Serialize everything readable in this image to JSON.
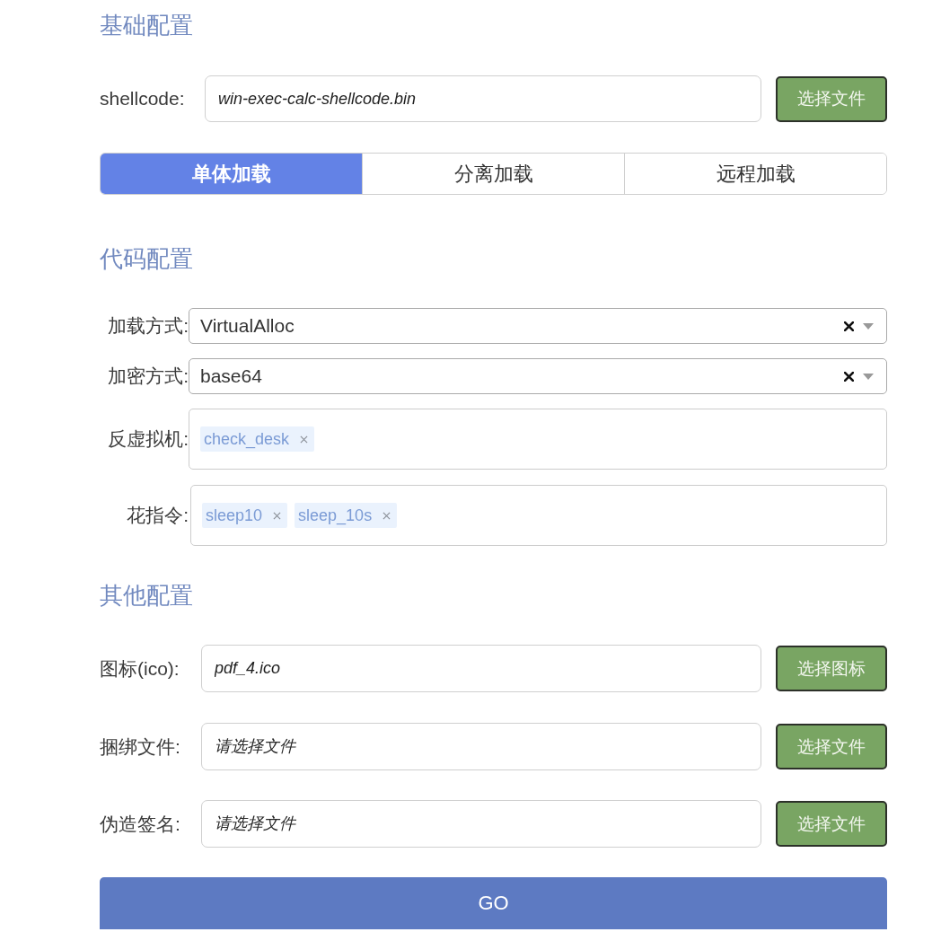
{
  "basic": {
    "title": "基础配置",
    "shellcode": {
      "label": "shellcode:",
      "value": "win-exec-calc-shellcode.bin",
      "button": "选择文件"
    },
    "modes": [
      {
        "label": "单体加载",
        "selected": true
      },
      {
        "label": "分离加载",
        "selected": false
      },
      {
        "label": "远程加载",
        "selected": false
      }
    ]
  },
  "code": {
    "title": "代码配置",
    "selects": [
      {
        "label": "加载方式:",
        "value": "VirtualAlloc"
      },
      {
        "label": "加密方式:",
        "value": "base64"
      }
    ],
    "multiselects": [
      {
        "label": "反虚拟机:",
        "tags": [
          "check_desk"
        ]
      },
      {
        "label": "花指令:",
        "tags": [
          "sleep10",
          "sleep_10s"
        ]
      }
    ]
  },
  "other": {
    "title": "其他配置",
    "files": [
      {
        "label": "图标(ico):",
        "value": "pdf_4.ico",
        "button": "选择图标"
      },
      {
        "label": "捆绑文件:",
        "placeholder": "请选择文件",
        "button": "选择文件"
      },
      {
        "label": "伪造签名:",
        "placeholder": "请选择文件",
        "button": "选择文件"
      }
    ]
  },
  "go_button": {
    "label": "GO"
  }
}
